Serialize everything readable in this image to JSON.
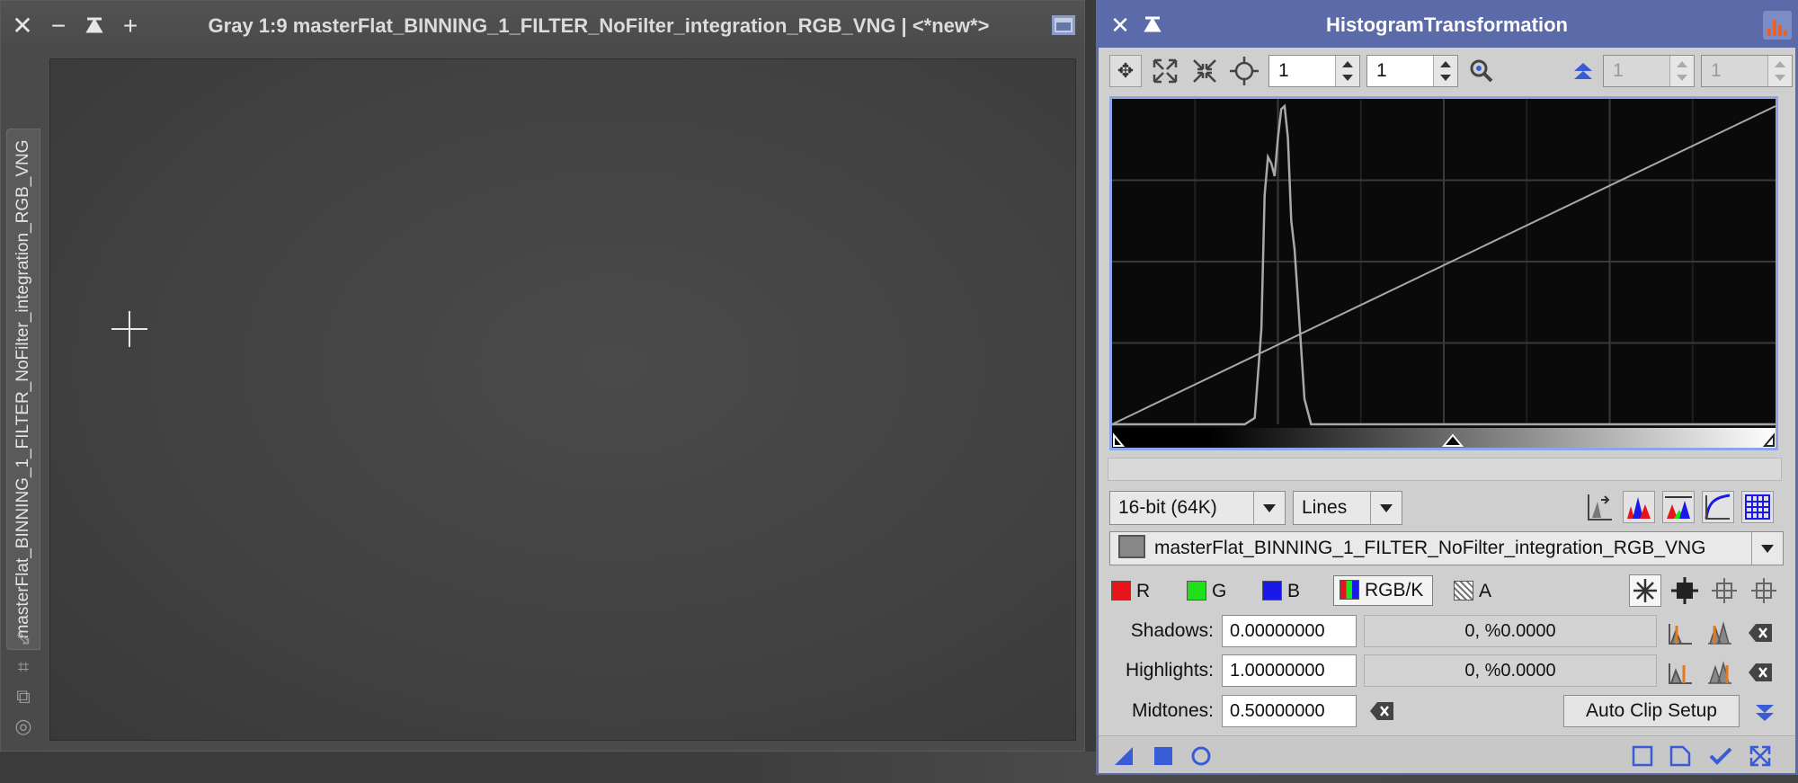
{
  "image_window": {
    "title": "Gray 1:9 masterFlat_BINNING_1_FILTER_NoFilter_integration_RGB_VNG | <*new*>",
    "vertical_tab_label": "masterFlat_BINNING_1_FILTER_NoFilter_integration_RGB_VNG",
    "buttons": [
      "close-icon",
      "minimize-icon",
      "shade-icon",
      "maximize-icon"
    ]
  },
  "panel": {
    "title": "HistogramTransformation",
    "toolbar": {
      "zoom_h": "1",
      "zoom_v": "1",
      "zoom_h2": "1",
      "zoom_v2": "1"
    },
    "resolution": "16-bit (64K)",
    "graph_style": "Lines",
    "view_selector": "masterFlat_BINNING_1_FILTER_NoFilter_integration_RGB_VNG",
    "channels": {
      "r": "R",
      "g": "G",
      "b": "B",
      "rgbk": "RGB/K",
      "a": "A",
      "colors": {
        "r": "#e8141b",
        "g": "#21e01b",
        "b": "#1a1ae8"
      }
    },
    "shadows": {
      "label": "Shadows:",
      "value": "0.00000000",
      "info": "0, %0.0000"
    },
    "highlights": {
      "label": "Highlights:",
      "value": "1.00000000",
      "info": "0, %0.0000"
    },
    "midtones": {
      "label": "Midtones:",
      "value": "0.50000000"
    },
    "auto_clip_label": "Auto Clip Setup"
  },
  "chart_data": {
    "type": "line",
    "series": [
      {
        "values": [
          [
            0.0,
            0
          ],
          [
            0.2,
            0
          ],
          [
            0.215,
            0.02
          ],
          [
            0.225,
            0.3
          ],
          [
            0.23,
            0.72
          ],
          [
            0.235,
            0.84
          ],
          [
            0.24,
            0.82
          ],
          [
            0.245,
            0.78
          ],
          [
            0.25,
            0.9
          ],
          [
            0.255,
            0.99
          ],
          [
            0.26,
            1.0
          ],
          [
            0.265,
            0.9
          ],
          [
            0.27,
            0.64
          ],
          [
            0.275,
            0.55
          ],
          [
            0.28,
            0.4
          ],
          [
            0.29,
            0.08
          ],
          [
            0.3,
            0.0
          ],
          [
            1.0,
            0.0
          ]
        ]
      },
      {
        "values": [
          [
            0.0,
            0.0
          ],
          [
            1.0,
            1.0
          ]
        ]
      }
    ],
    "xlim": [
      0,
      1
    ],
    "ylim": [
      0,
      1
    ],
    "grid": true
  }
}
